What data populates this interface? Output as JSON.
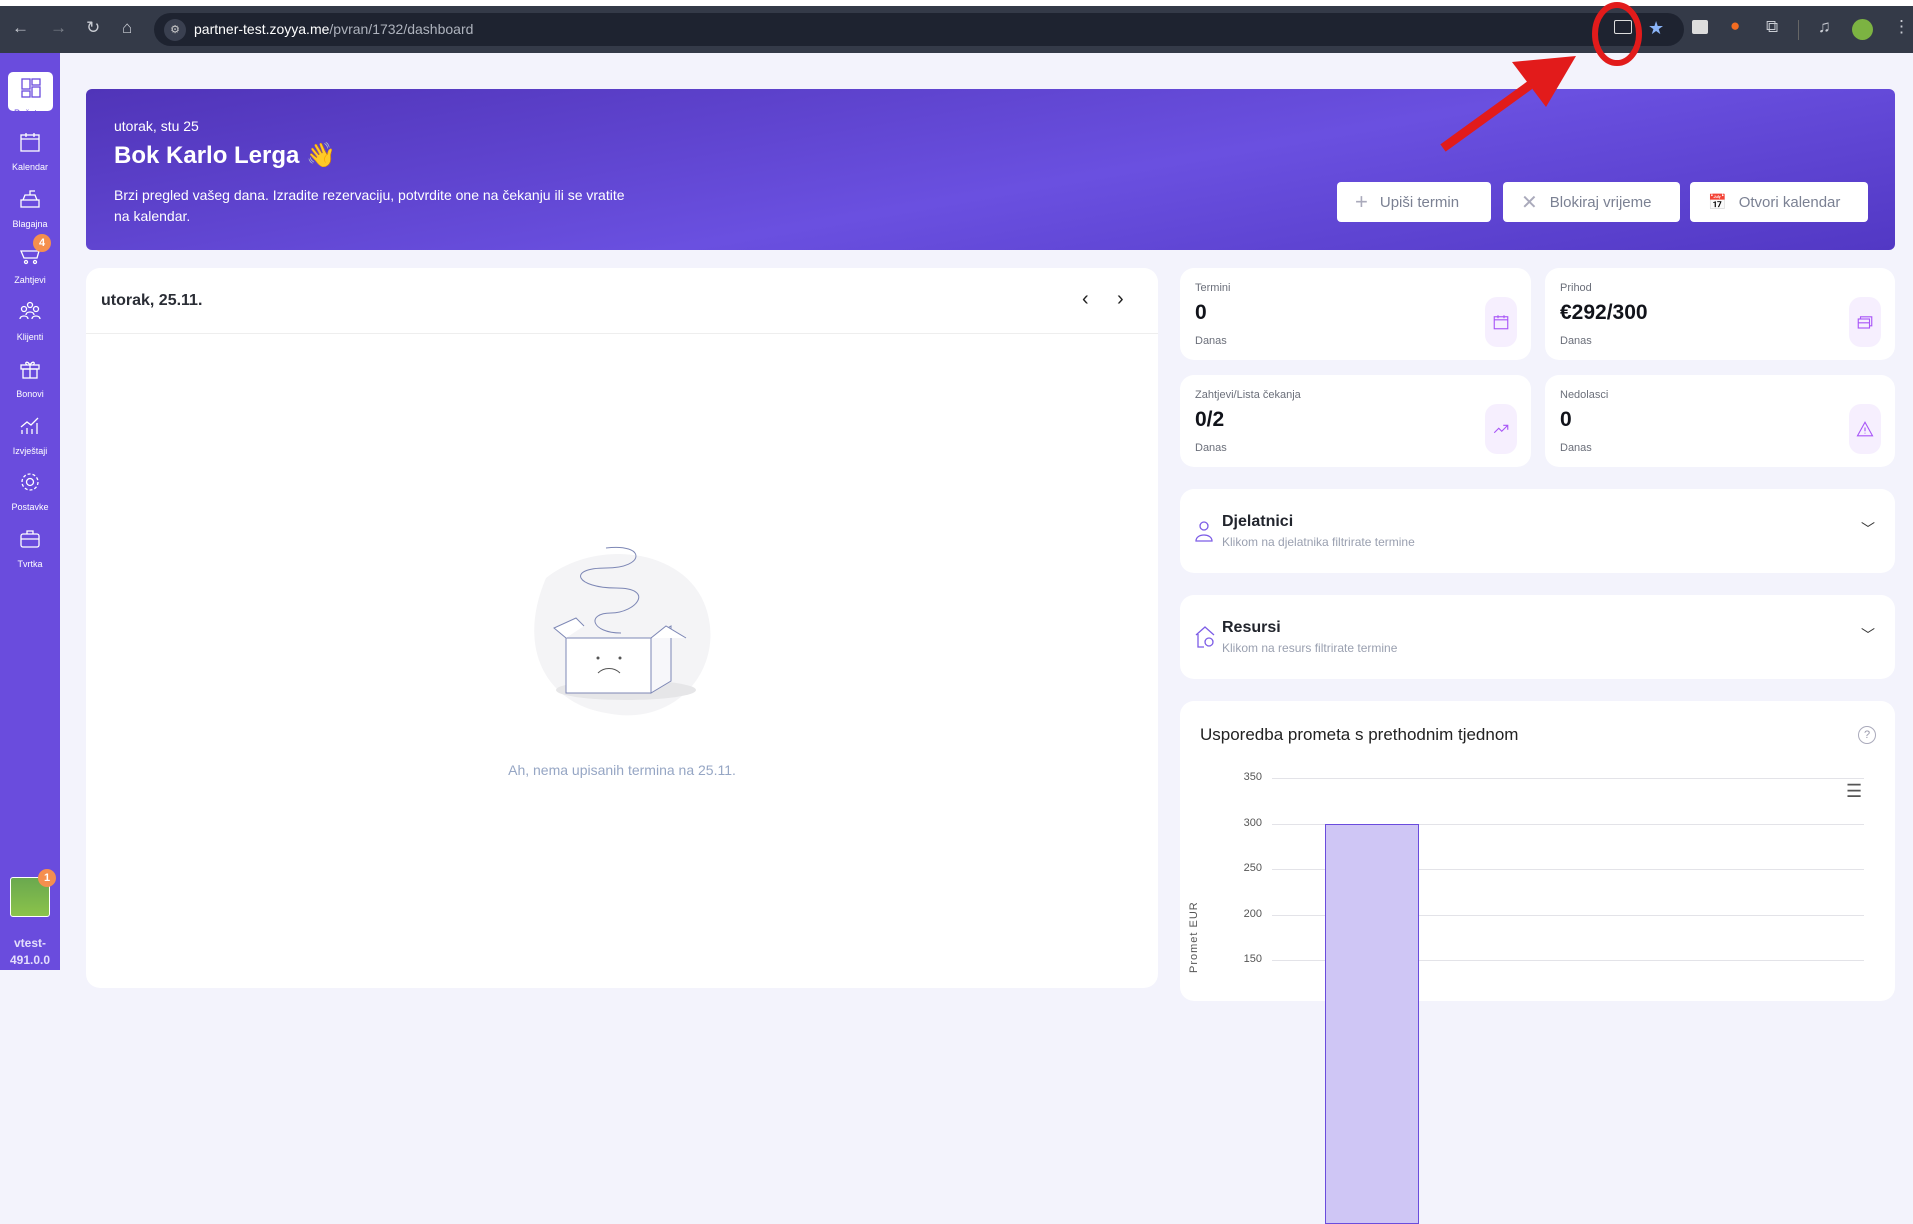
{
  "browser": {
    "url_host": "partner-test.zoyya.me",
    "url_path": "/pvran/1732/dashboard"
  },
  "sidebar": {
    "items": [
      {
        "label": "Početna",
        "icon": "dashboard-icon"
      },
      {
        "label": "Kalendar",
        "icon": "calendar-icon"
      },
      {
        "label": "Blagajna",
        "icon": "cash-register-icon"
      },
      {
        "label": "Zahtjevi",
        "icon": "cart-icon",
        "badge": "4"
      },
      {
        "label": "Klijenti",
        "icon": "clients-icon"
      },
      {
        "label": "Bonovi",
        "icon": "gift-icon"
      },
      {
        "label": "Izvještaji",
        "icon": "reports-icon"
      },
      {
        "label": "Postavke",
        "icon": "settings-icon"
      },
      {
        "label": "Tvrtka",
        "icon": "briefcase-icon"
      }
    ],
    "avatar_badge": "1",
    "version_line1": "vtest-",
    "version_line2": "491.0.0"
  },
  "hero": {
    "date": "utorak, stu 25",
    "greeting": "Bok Karlo Lerga",
    "emoji": "👋",
    "description_line1": "Brzi pregled vašeg dana. Izradite rezervaciju, potvrdite one na čekanju ili se vratite",
    "description_line2": "na kalendar.",
    "buttons": [
      {
        "label": "Upiši termin",
        "icon": "plus-icon"
      },
      {
        "label": "Blokiraj vrijeme",
        "icon": "x-icon"
      },
      {
        "label": "Otvori kalendar",
        "icon": "calendar-icon"
      }
    ]
  },
  "day": {
    "title": "utorak, 25.11.",
    "empty_text": "Ah, nema upisanih termina na 25.11."
  },
  "stats": [
    {
      "title": "Termini",
      "value": "0",
      "sub": "Danas"
    },
    {
      "title": "Prihod",
      "value": "€292/300",
      "sub": "Danas"
    },
    {
      "title": "Zahtjevi/Lista čekanja",
      "value": "0/2",
      "sub": "Danas"
    },
    {
      "title": "Nedolasci",
      "value": "0",
      "sub": "Danas"
    }
  ],
  "panels": [
    {
      "title": "Djelatnici",
      "sub": "Klikom na djelatnika filtrirate termine"
    },
    {
      "title": "Resursi",
      "sub": "Klikom na resurs filtrirate termine"
    }
  ],
  "colors": {
    "accent": "#6a4cdd",
    "bar": "#cfc6f5",
    "bar_border": "#6a4cdd"
  },
  "chart_data": {
    "type": "bar",
    "title": "Usporedba prometa s prethodnim tjednom",
    "ylabel": "Promet EUR",
    "yticks": [
      150,
      200,
      250,
      300,
      350
    ],
    "ylim": [
      150,
      350
    ],
    "values": [
      300
    ],
    "grid": true
  }
}
